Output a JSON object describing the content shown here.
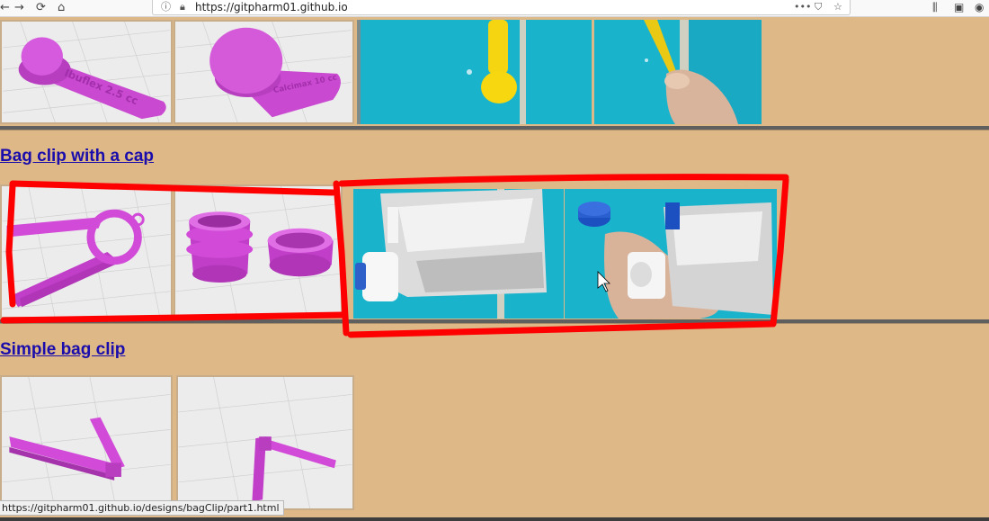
{
  "browser": {
    "url": "https://gitpharm01.github.io",
    "back_icon": "arrow-left-icon",
    "forward_icon": "arrow-right-icon",
    "reload_icon": "reload-icon",
    "home_icon": "home-icon",
    "lock_icon": "lock-icon",
    "info_icon": "info-icon",
    "more_icon": "more-dots-icon",
    "pocket_icon": "pocket-icon",
    "bookmark_icon": "star-icon",
    "library_icon": "library-icon",
    "sidebar_icon": "sidebar-icon",
    "account_icon": "account-icon"
  },
  "sections": [
    {
      "title": "Bag clip with a cap"
    },
    {
      "title": "Simple bag clip"
    }
  ],
  "top_row_text": {
    "spoon1_engraving": "Ibuflex 2.5 cc",
    "spoon2_engraving": "Calcimax 10 cc"
  },
  "status_bar": "https://gitpharm01.github.io/designs/bagClip/part1.html",
  "colors": {
    "page_bg": "#deb887",
    "link": "#1a0dab",
    "annotation": "#ff0000",
    "model_magenta": "#d24ad8",
    "photo_cyan": "#1ab3cc"
  }
}
